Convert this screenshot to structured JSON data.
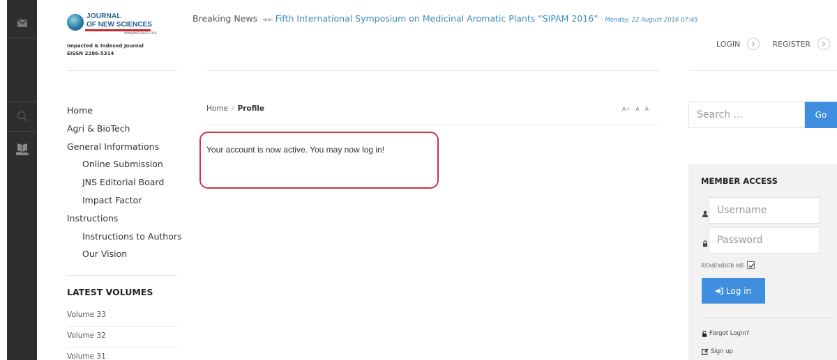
{
  "logo": {
    "line1": "JOURNAL",
    "line2": "OF NEW SCIENCES",
    "url": "WWW.JNSCIENCES.ORG",
    "tagline": "Impacted & Indexed Journal",
    "issn": "EISSN 2286-5314"
  },
  "news": {
    "label": "Breaking News",
    "title": "Fifth International Symposium on Medicinal Aromatic Plants “SIPAM 2016”",
    "date": "- Monday, 22 August 2016 07:45"
  },
  "top_links": {
    "login": "LOGIN",
    "register": "REGISTER"
  },
  "nav": [
    {
      "label": "Home",
      "sub": false
    },
    {
      "label": "Agri & BioTech",
      "sub": false
    },
    {
      "label": "General Informations",
      "sub": false
    },
    {
      "label": "Online Submission",
      "sub": true
    },
    {
      "label": "JNS Editorial Board",
      "sub": true
    },
    {
      "label": "Impact Factor",
      "sub": true
    },
    {
      "label": "Instructions",
      "sub": false
    },
    {
      "label": "Instructions to Authors",
      "sub": true
    },
    {
      "label": "Our Vision",
      "sub": true
    }
  ],
  "latest": {
    "title": "LATEST VOLUMES",
    "volumes": [
      "Volume 33",
      "Volume 32",
      "Volume 31"
    ]
  },
  "breadcrumb": {
    "home": "Home",
    "separator": "/",
    "current": "Profile"
  },
  "font_tools": [
    "A+",
    "A",
    "A-"
  ],
  "message": "Your account is now active. You may now log in!",
  "search": {
    "placeholder": "Search ...",
    "button": "Go"
  },
  "member": {
    "title": "MEMBER ACCESS",
    "username_placeholder": "Username",
    "password_placeholder": "Password",
    "remember": "REMEMBER ME",
    "remember_checked": true,
    "login_button": "Log in",
    "forgot": "Forgot Login?",
    "signup": "Sign up"
  },
  "icons": {
    "rail": [
      "envelope-icon",
      "search-icon",
      "book-hand-icon"
    ],
    "user": "user-icon",
    "lock": "lock-icon",
    "sign_in": "sign-in-icon",
    "edit": "edit-icon"
  },
  "colors": {
    "accent": "#3f8ee0",
    "news_link": "#3a8cb8",
    "highlight_border": "#c9363e",
    "rail": "#2e2e2e"
  }
}
